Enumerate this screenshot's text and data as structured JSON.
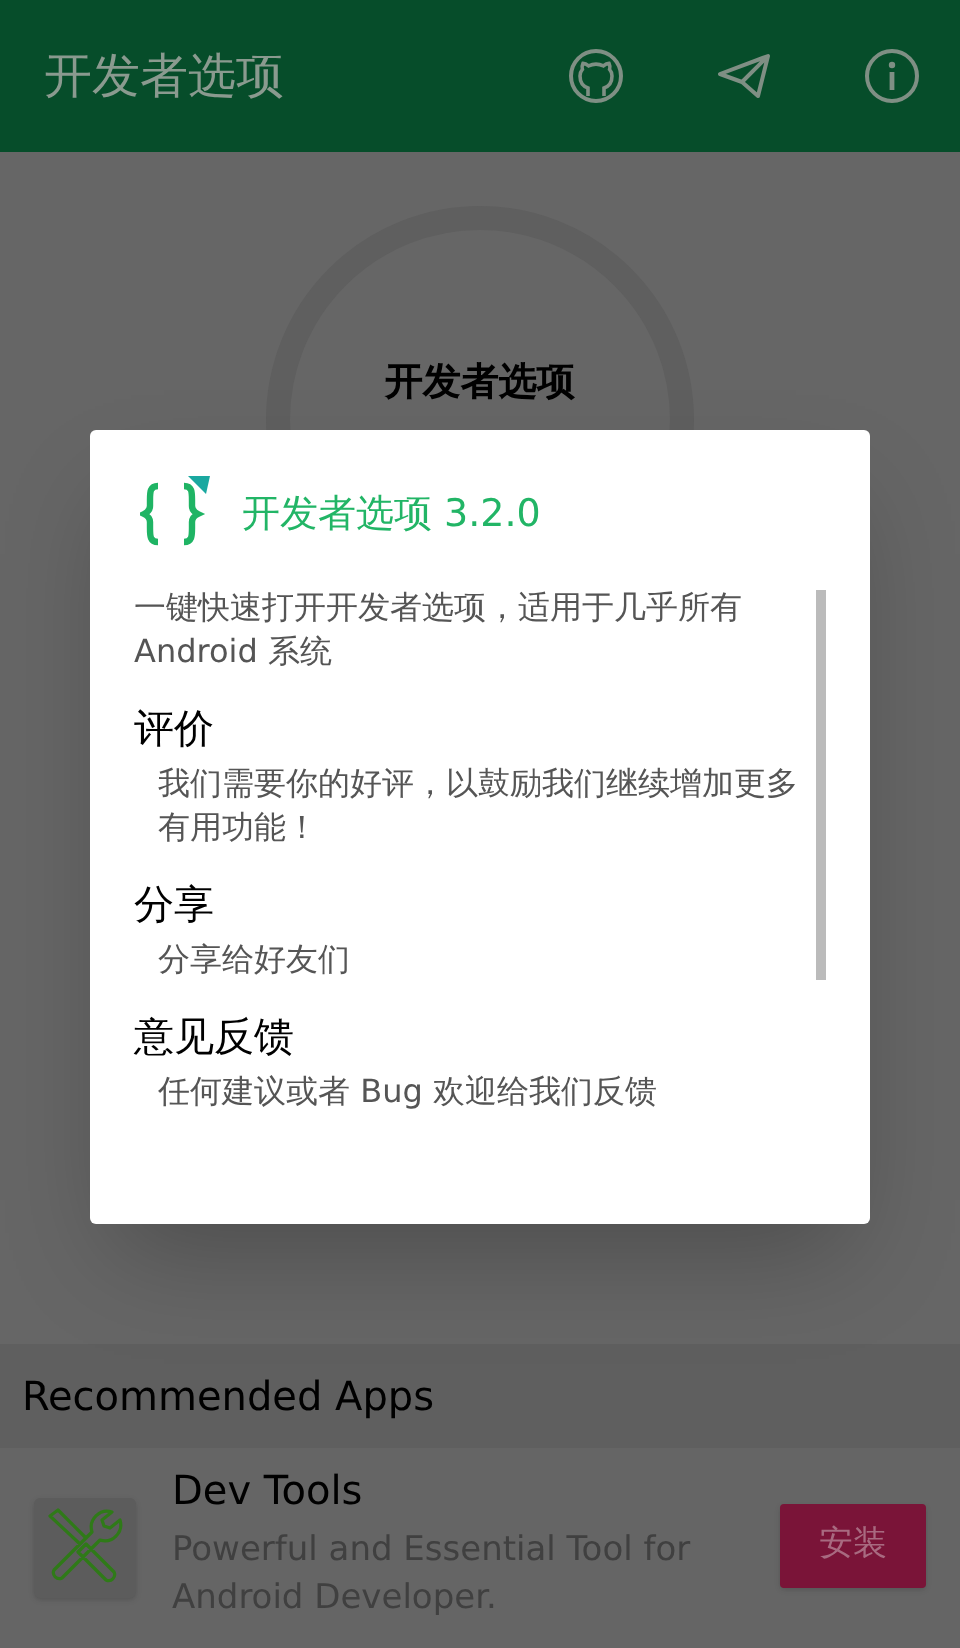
{
  "app_bar": {
    "title": "开发者选项"
  },
  "home": {
    "circle_label": "开发者选项"
  },
  "dialog": {
    "title": "开发者选项 3.2.0",
    "description": "一键快速打开开发者选项，适用于几乎所有 Android 系统",
    "sections": [
      {
        "heading": "评价",
        "text": "我们需要你的好评，以鼓励我们继续增加更多有用功能！"
      },
      {
        "heading": "分享",
        "text": "分享给好友们"
      },
      {
        "heading": "意见反馈",
        "text": "任何建议或者 Bug 欢迎给我们反馈"
      }
    ]
  },
  "recommended": {
    "title": "Recommended Apps",
    "apps": [
      {
        "name": "Dev Tools",
        "description": "Powerful and Essential Tool for Android Developer.",
        "button": "安装"
      }
    ]
  }
}
